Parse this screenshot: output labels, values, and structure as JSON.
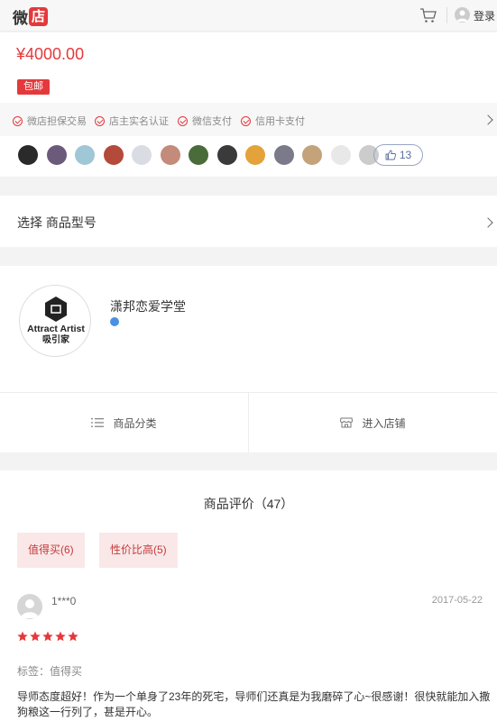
{
  "header": {
    "logo_text_a": "微",
    "logo_text_b": "店",
    "login_label": "登录"
  },
  "product": {
    "price": "¥4000.00",
    "shipping_badge": "包邮"
  },
  "guarantees": [
    {
      "label": "微店担保交易"
    },
    {
      "label": "店主实名认证"
    },
    {
      "label": "微信支付"
    },
    {
      "label": "信用卡支付"
    }
  ],
  "likes": {
    "count": "13",
    "avatar_colors": [
      "#2a2a2a",
      "#6b5a7a",
      "#9fc7d6",
      "#b34a3a",
      "#d9dde3",
      "#c48a7a",
      "#4a6b3a",
      "#3a3a3a",
      "#e4a23a",
      "#7a7a8a",
      "#c4a27a",
      "#e8e8e8",
      "#cccccc"
    ]
  },
  "select": {
    "label": "选择 商品型号"
  },
  "shop": {
    "name": "潇邦恋爱学堂",
    "logo_line1": "Attract Artist",
    "logo_line2": "吸引家",
    "category_label": "商品分类",
    "enter_label": "进入店铺"
  },
  "reviews": {
    "title": "商品评价（47）",
    "tags": [
      {
        "label": "值得买(6)"
      },
      {
        "label": "性价比高(5)"
      }
    ],
    "items": [
      {
        "user": "1***0",
        "date": "2017-05-22",
        "rating": 5,
        "tag": "标签：值得买",
        "text": "导师态度超好！作为一个单身了23年的死宅，导师们还真是为我磨碎了心~很感谢！很快就能加入撒狗粮这一行列了，甚是开心。"
      }
    ]
  },
  "colors": {
    "accent": "#e4393c",
    "like_border": "#99a5c4"
  }
}
